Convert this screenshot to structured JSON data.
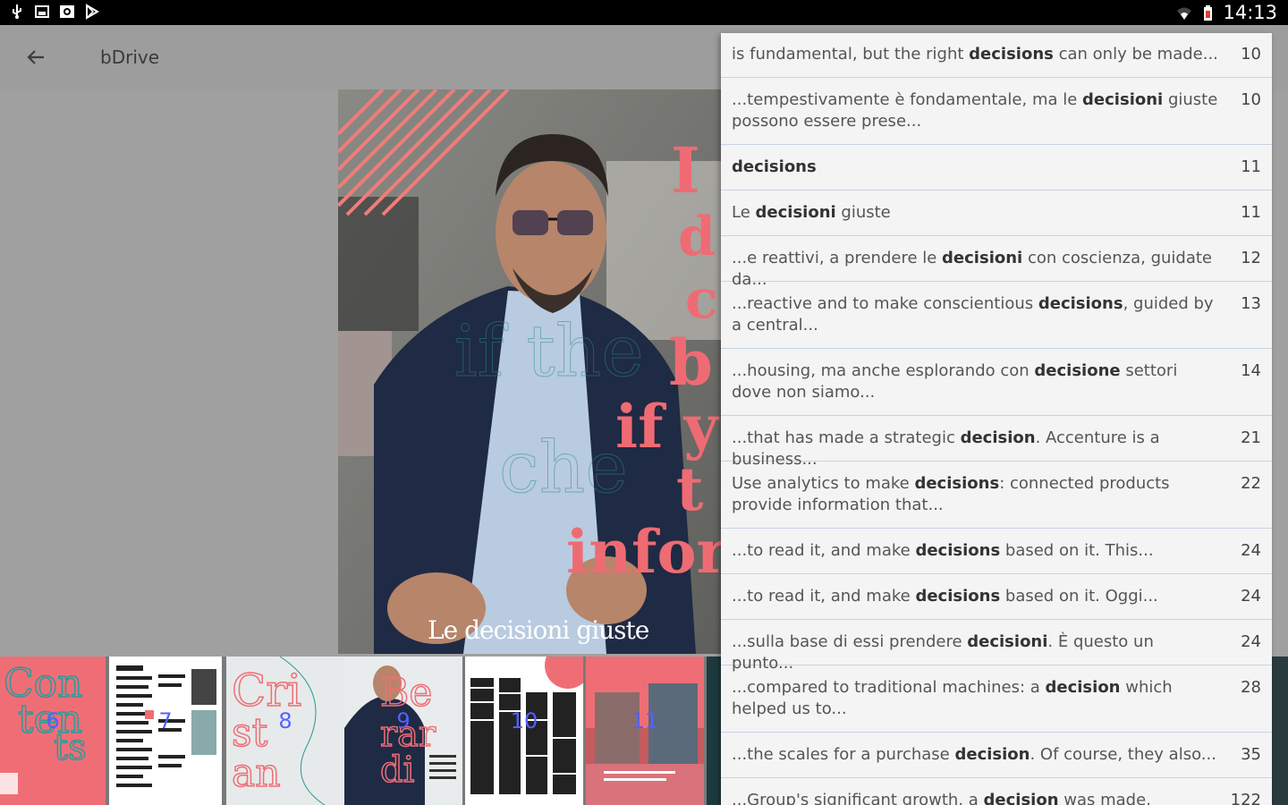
{
  "status_bar": {
    "time": "14:13",
    "icons": [
      "usb-icon",
      "screenshot-icon",
      "photo-icon",
      "play-store-icon",
      "wifi-icon",
      "battery-icon"
    ]
  },
  "toolbar": {
    "back_icon": "back-arrow-icon",
    "title": "bDrive"
  },
  "page": {
    "caption": "Le decisioni giuste"
  },
  "thumbnails": [
    {
      "num": "6"
    },
    {
      "num": "7"
    },
    {
      "num": "8"
    },
    {
      "num": "9"
    },
    {
      "num": "10"
    },
    {
      "num": "11"
    }
  ],
  "results": [
    {
      "pre": "is fundamental, but the right ",
      "term": "decisions",
      "post": " can only be made...",
      "page": "10"
    },
    {
      "pre": "...tempestivamente è fondamentale, ma le ",
      "term": "decisioni",
      "post": " giuste possono essere prese...",
      "page": "10"
    },
    {
      "pre": "",
      "term": "decisions",
      "post": "",
      "page": "11"
    },
    {
      "pre": "Le ",
      "term": "decisioni",
      "post": " giuste",
      "page": "11"
    },
    {
      "pre": "...e reattivi, a prendere le ",
      "term": "decisioni",
      "post": " con coscienza, guidate da...",
      "page": "12"
    },
    {
      "pre": "...reactive and to make conscientious ",
      "term": "decisions",
      "post": ", guided by a central...",
      "page": "13"
    },
    {
      "pre": "...housing, ma anche esplorando con ",
      "term": "decisione",
      "post": " settori dove non siamo...",
      "page": "14"
    },
    {
      "pre": "...that has made a strategic ",
      "term": "decision",
      "post": ". Accenture is a business...",
      "page": "21"
    },
    {
      "pre": "Use analytics to make ",
      "term": "decisions",
      "post": ": connected products provide information that...",
      "page": "22"
    },
    {
      "pre": "...to read it, and make ",
      "term": "decisions",
      "post": " based on it. This...",
      "page": "24"
    },
    {
      "pre": "...to read it, and make ",
      "term": "decisions",
      "post": " based on it. Oggi...",
      "page": "24"
    },
    {
      "pre": "...sulla base di essi prendere ",
      "term": "decisioni",
      "post": ". È questo un punto...",
      "page": "24"
    },
    {
      "pre": "...compared to traditional machines: a ",
      "term": "decision",
      "post": " which helped us to...",
      "page": "28"
    },
    {
      "pre": "...the scales for a purchase ",
      "term": "decision",
      "post": ". Of course, they also...",
      "page": "35"
    },
    {
      "pre": "...Group's significant growth, a ",
      "term": "decision",
      "post": " was made, already...",
      "page": "122"
    }
  ]
}
